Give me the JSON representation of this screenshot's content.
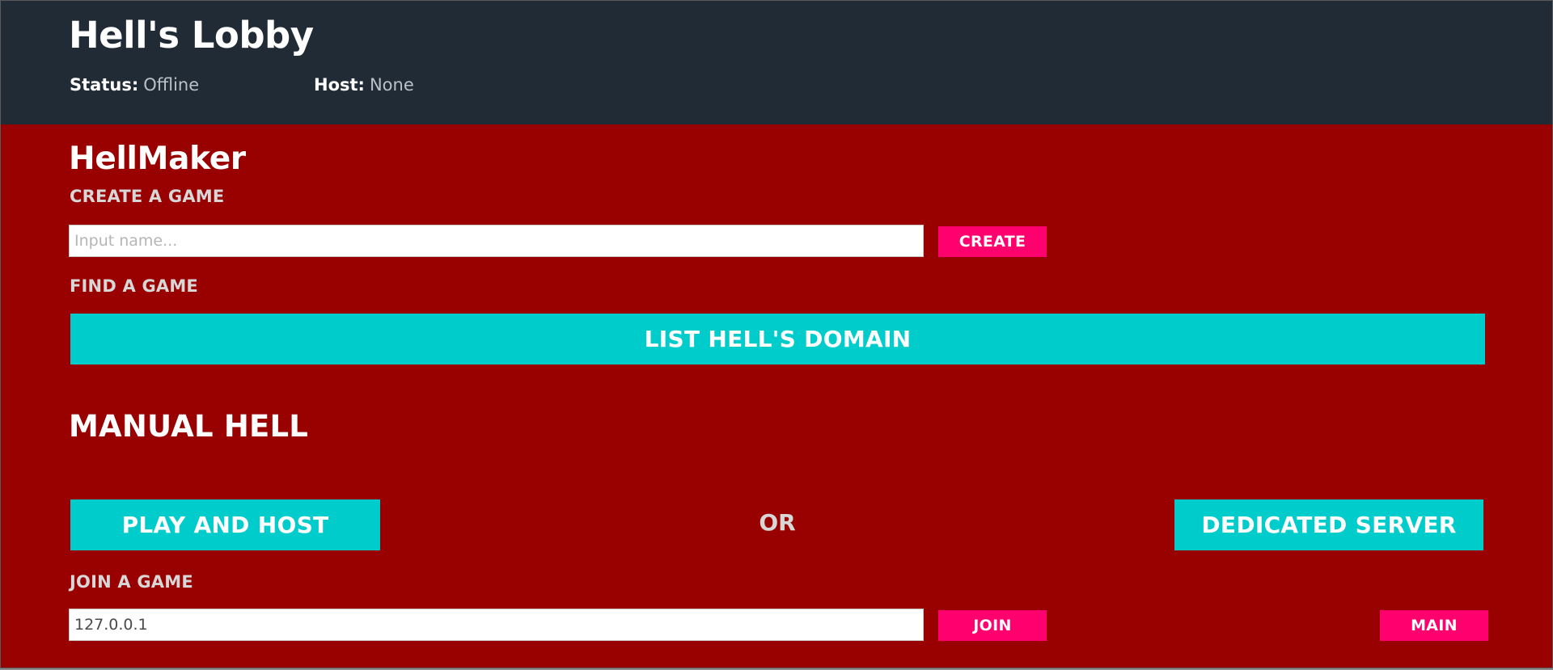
{
  "header": {
    "title": "Hell's Lobby",
    "status_label": "Status:",
    "status_value": "Offline",
    "host_label": "Host:",
    "host_value": "None"
  },
  "hellmaker": {
    "title": "HellMaker",
    "create_label": "CREATE A GAME",
    "create_input_placeholder": "Input name...",
    "create_input_value": "",
    "create_button": "CREATE",
    "find_label": "FIND A GAME",
    "list_button": "LIST HELL'S DOMAIN"
  },
  "manual": {
    "title": "MANUAL HELL",
    "play_host_button": "PLAY AND HOST",
    "or_text": "OR",
    "dedicated_button": "DEDICATED SERVER",
    "join_label": "JOIN A GAME",
    "join_input_value": "127.0.0.1",
    "join_button": "JOIN",
    "main_button": "MAIN"
  },
  "colors": {
    "header_bg": "#212b35",
    "panel_bg": "#990000",
    "accent_pink": "#ff006e",
    "accent_cyan": "#00cccc"
  }
}
